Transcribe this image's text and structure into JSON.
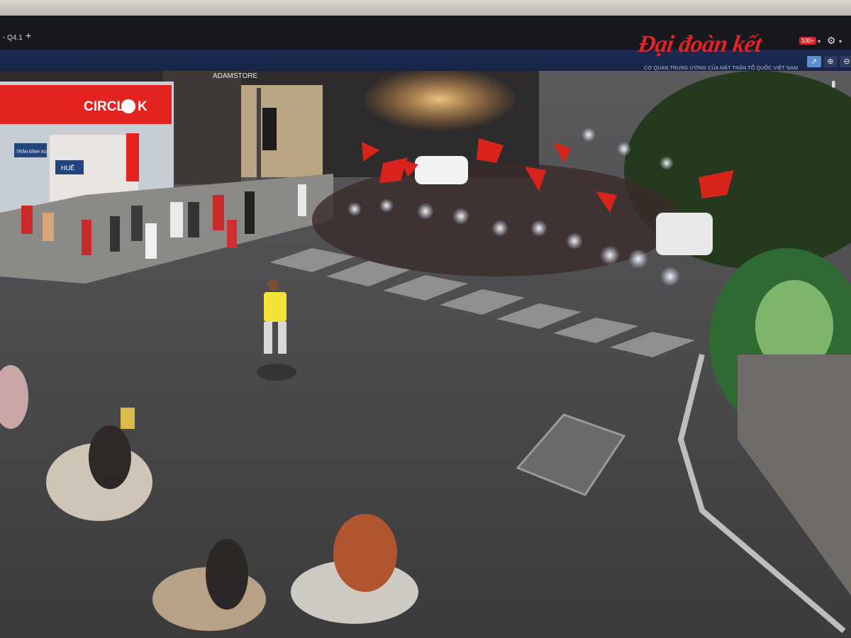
{
  "browser": {
    "tab_label": "- Q4.1",
    "new_tab_symbol": "+"
  },
  "site": {
    "logo_text": "Đại đoàn kết",
    "tagline": "CƠ QUAN TRUNG ƯƠNG CỦA MẶT TRẬN TỔ QUỐC VIỆT NAM",
    "notification_count": "100+",
    "logo_color": "#e32226"
  },
  "toolbar": {
    "pointer_icon": "cursor-icon",
    "zoom_in_icon": "zoom-in-icon",
    "zoom_out_icon": "zoom-out-icon",
    "settings_icon": "gear-icon"
  },
  "scene": {
    "store_sign": "CIRCLE K",
    "store_sign_color": "#e3231f",
    "shop_name": "ADAMSTORE",
    "street_sign_1": "TRẦN ĐÌNH XU",
    "street_sign_2": "HUẾ",
    "flag_color": "#d8231b",
    "shirt_color": "#f2e23a"
  }
}
